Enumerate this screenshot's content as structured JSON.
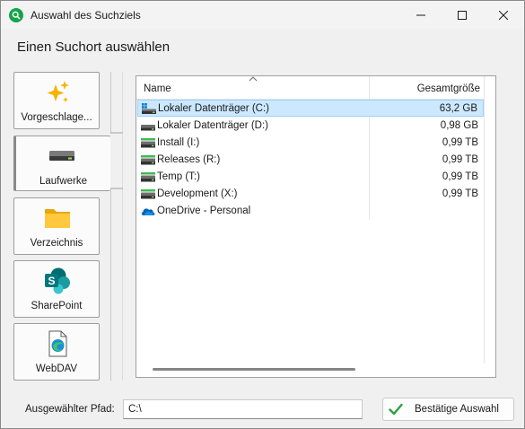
{
  "window": {
    "title": "Auswahl des Suchziels"
  },
  "header": {
    "title": "Einen Suchort auswählen"
  },
  "sidebar": {
    "items": [
      {
        "label": "Vorgeschlage...",
        "icon": "sparkle-icon",
        "active": false
      },
      {
        "label": "Laufwerke",
        "icon": "drive-icon",
        "active": true
      },
      {
        "label": "Verzeichnis",
        "icon": "folder-icon",
        "active": false
      },
      {
        "label": "SharePoint",
        "icon": "sharepoint-icon",
        "active": false
      },
      {
        "label": "WebDAV",
        "icon": "webdav-icon",
        "active": false
      }
    ]
  },
  "list": {
    "columns": {
      "name": "Name",
      "size": "Gesamtgröße"
    },
    "rows": [
      {
        "name": "Lokaler Datenträger (C:)",
        "size": "63,2 GB",
        "icon": "system-drive-icon",
        "selected": true
      },
      {
        "name": "Lokaler Datenträger (D:)",
        "size": "0,98 GB",
        "icon": "drive-icon",
        "selected": false
      },
      {
        "name": "Install (I:)",
        "size": "0,99 TB",
        "icon": "network-drive-icon",
        "selected": false
      },
      {
        "name": "Releases (R:)",
        "size": "0,99 TB",
        "icon": "network-drive-icon",
        "selected": false
      },
      {
        "name": "Temp (T:)",
        "size": "0,99 TB",
        "icon": "network-drive-icon",
        "selected": false
      },
      {
        "name": "Development (X:)",
        "size": "0,99 TB",
        "icon": "network-drive-icon",
        "selected": false
      },
      {
        "name": "OneDrive - Personal",
        "size": "",
        "icon": "onedrive-icon",
        "selected": false
      }
    ]
  },
  "footer": {
    "path_label": "Ausgewählter Pfad:",
    "path_value": "C:\\",
    "confirm_label": "Bestätige Auswahl"
  },
  "colors": {
    "accent": "#0067c0",
    "selection": "#cce8ff",
    "app_icon": "#16a34a"
  }
}
